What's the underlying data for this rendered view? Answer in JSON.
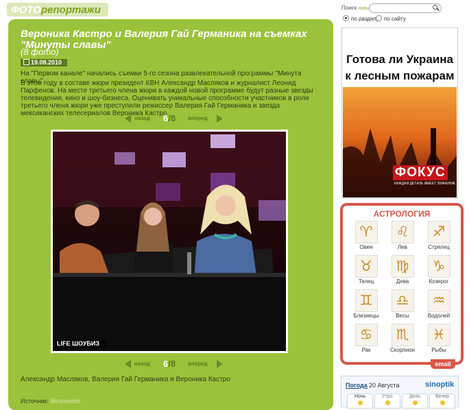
{
  "header": {
    "logo_part1": "ФОТО",
    "logo_part2": "репортажи"
  },
  "search": {
    "label": "Поиск",
    "sublabel": "новый",
    "placeholder": "",
    "option_section": "по разделу",
    "option_site": "по сайту"
  },
  "article": {
    "title": "Вероника Кастро и Валерия Гай Германика на съемках \"Минуты славы\"",
    "photo_count": "(8 фото)",
    "date": "19.08.2010",
    "lead": "На \"Первом канале\" начались съемки 5-го сезона развлекательной программы \"Минута славы\".",
    "body": "В этом году в составе жюри президент КВН Александр Масляков и журналист Леонид Парфенов. На месте третьего члена жюри в каждой новой программе будут разные звезды телевидения, кино и шоу-бизнеса. Оценивать уникальные способности участников в роли третьего члена жюри уже преступили режиссер Валерия Гай Германика и звезда мексиканских телесериалов Вероника Кастро.",
    "caption": "Александр Масляков, Валерия Гай Германика и Вероника Кастро",
    "source_label": "Источник:",
    "source_link": "lifeshowbiz",
    "watermark": "LIFE ШОУБИЗ"
  },
  "pager": {
    "prev": "назад",
    "next": "вперед",
    "current": "6",
    "total": "/8"
  },
  "ad": {
    "title_line1": "Готова ли Украина",
    "title_line2": "к лесным пожарам",
    "logo": "ФОКУС",
    "tagline": "КАЖДАЯ ДЕТАЛЬ ИМЕЕТ ЗНАЧЕНИЕ"
  },
  "astrology": {
    "title": "АСТРОЛОГИЯ",
    "signs": [
      {
        "name": "Овен",
        "glyph": "♈",
        "icon": "aries-icon"
      },
      {
        "name": "Лев",
        "glyph": "♌",
        "icon": "leo-icon"
      },
      {
        "name": "Стрелец",
        "glyph": "♐",
        "icon": "sagittarius-icon"
      },
      {
        "name": "Телец",
        "glyph": "♉",
        "icon": "taurus-icon"
      },
      {
        "name": "Дева",
        "glyph": "♍",
        "icon": "virgo-icon"
      },
      {
        "name": "Козерог",
        "glyph": "♑",
        "icon": "capricorn-icon"
      },
      {
        "name": "Близнецы",
        "glyph": "♊",
        "icon": "gemini-icon"
      },
      {
        "name": "Весы",
        "glyph": "♎",
        "icon": "libra-icon"
      },
      {
        "name": "Водолей",
        "glyph": "♒",
        "icon": "aquarius-icon"
      },
      {
        "name": "Рак",
        "glyph": "♋",
        "icon": "cancer-icon"
      },
      {
        "name": "Скорпион",
        "glyph": "♏",
        "icon": "scorpio-icon"
      },
      {
        "name": "Рыбы",
        "glyph": "♓",
        "icon": "pisces-icon"
      }
    ],
    "email_label": "email"
  },
  "weather": {
    "link": "Погода",
    "date": "20 Августа",
    "logo": "sinoptik",
    "tabs": [
      "Ночь",
      "Утро",
      "День",
      "Вечер"
    ]
  },
  "colors": {
    "panel_green": "#9bc23b",
    "astro_red": "#d9574a",
    "header_green": "#dbe8b8"
  }
}
